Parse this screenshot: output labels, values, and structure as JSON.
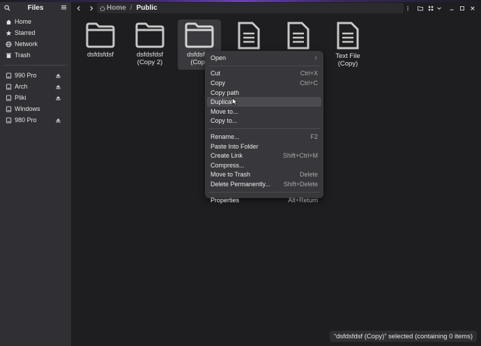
{
  "window": {
    "sidebar_title": "Files"
  },
  "sidebar": {
    "places": [
      {
        "label": "Home",
        "icon": "home-icon"
      },
      {
        "label": "Starred",
        "icon": "star-icon"
      },
      {
        "label": "Network",
        "icon": "network-icon"
      },
      {
        "label": "Trash",
        "icon": "trash-icon"
      }
    ],
    "drives": [
      {
        "label": "990 Pro",
        "icon": "drive-icon",
        "ejectable": true
      },
      {
        "label": "Arch",
        "icon": "drive-icon",
        "ejectable": true
      },
      {
        "label": "Pliki",
        "icon": "drive-icon",
        "ejectable": true
      },
      {
        "label": "Windows",
        "icon": "drive-icon",
        "ejectable": false
      },
      {
        "label": "980 Pro",
        "icon": "drive-icon",
        "ejectable": true
      }
    ]
  },
  "toolbar": {
    "breadcrumb_home": "Home",
    "breadcrumb_separator": "/",
    "breadcrumb_current": "Public"
  },
  "files": [
    {
      "name": "dsfdsfdsf",
      "type": "folder",
      "selected": false
    },
    {
      "name": "dsfdsfdsf (Copy 2)",
      "line1": "dsfdsfdsf",
      "line2": "(Copy 2)",
      "type": "folder",
      "selected": false
    },
    {
      "name": "dsfdsfdsf (Copy)",
      "line1": "dsfdsfds",
      "line2": "(Copy",
      "type": "folder",
      "selected": true
    },
    {
      "name": "",
      "type": "document",
      "selected": false
    },
    {
      "name": "",
      "type": "document",
      "selected": false
    },
    {
      "name": "Text File (Copy)",
      "line1": "Text File",
      "line2": "(Copy)",
      "type": "document",
      "selected": false
    }
  ],
  "context_menu": {
    "groups": [
      [
        {
          "label": "Open",
          "accel": "",
          "submenu": true
        }
      ],
      [
        {
          "label": "Cut",
          "accel": "Ctrl+X"
        },
        {
          "label": "Copy",
          "accel": "Ctrl+C"
        },
        {
          "label": "Copy path",
          "accel": ""
        },
        {
          "label": "Duplicate",
          "accel": "",
          "highlighted": true
        },
        {
          "label": "Move to...",
          "accel": ""
        },
        {
          "label": "Copy to...",
          "accel": ""
        }
      ],
      [
        {
          "label": "Rename...",
          "accel": "F2"
        },
        {
          "label": "Paste Into Folder",
          "accel": ""
        },
        {
          "label": "Create Link",
          "accel": "Shift+Ctrl+M"
        },
        {
          "label": "Compress...",
          "accel": ""
        },
        {
          "label": "Move to Trash",
          "accel": "Delete"
        },
        {
          "label": "Delete Permanently...",
          "accel": "Shift+Delete"
        }
      ],
      [
        {
          "label": "Properties",
          "accel": "Alt+Return"
        }
      ]
    ]
  },
  "status": {
    "text": "“dsfdsfdsf (Copy)” selected (containing 0 items)"
  },
  "colors": {
    "accent": "#6a3fbf",
    "window_bg": "#1e1e20",
    "sidebar_bg": "#303034",
    "menu_bg": "#38383c"
  }
}
